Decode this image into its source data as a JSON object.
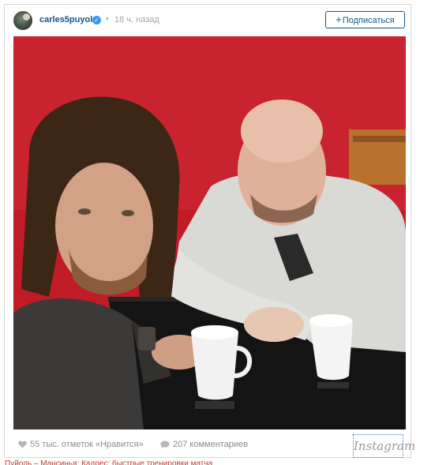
{
  "post": {
    "username": "carles5puyol",
    "verified_icon": "verified-check-icon",
    "separator": "•",
    "time": "18 ч. назад",
    "follow_label": "Подписаться",
    "follow_icon": "+"
  },
  "photo": {
    "description": "selfie-two-men-table-red-wall"
  },
  "footer": {
    "likes": "55 тыс. отметок «Нравится»",
    "comments": "207 комментариев",
    "brand": "Instagram"
  },
  "caption": "Пуйоль – Мансинья: Кадрес: быстрые тренировки матча"
}
